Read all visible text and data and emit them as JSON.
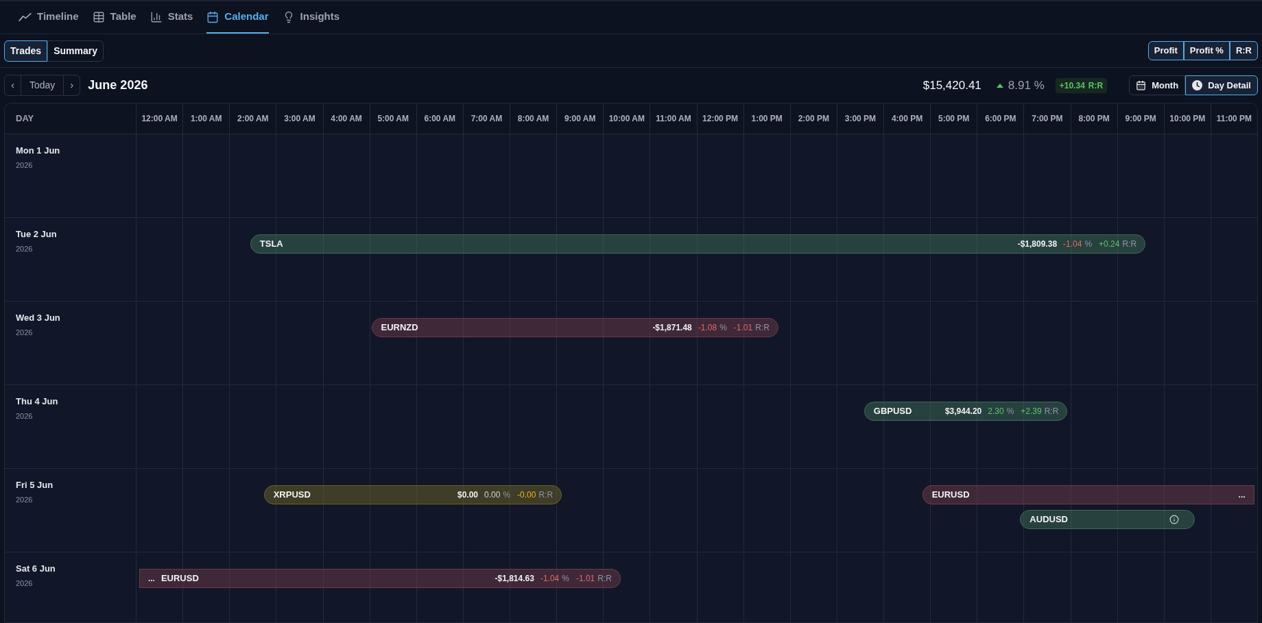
{
  "nav_tabs": [
    {
      "label": "Timeline",
      "selected": false
    },
    {
      "label": "Table",
      "selected": false
    },
    {
      "label": "Stats",
      "selected": false
    },
    {
      "label": "Calendar",
      "selected": true
    },
    {
      "label": "Insights",
      "selected": false
    }
  ],
  "view_toggle": [
    {
      "label": "Trades",
      "selected": true
    },
    {
      "label": "Summary",
      "selected": false
    }
  ],
  "metric_toggle": [
    {
      "label": "Profit",
      "selected": true
    },
    {
      "label": "Profit %",
      "selected": true
    },
    {
      "label": "R:R",
      "selected": true
    }
  ],
  "period_nav": {
    "previous": "‹",
    "today": "Today",
    "next": "›",
    "title": "June 2026"
  },
  "summary": {
    "profit": "$15,420.41",
    "rising": true,
    "percent": "8.91 %",
    "rr": {
      "value": "+10.34",
      "unit": "R:R",
      "color": "#5cc46a"
    }
  },
  "range_toggle": [
    {
      "label": "Month",
      "selected": false
    },
    {
      "label": "Day Detail",
      "selected": true
    }
  ],
  "calendar": {
    "day_heading": "DAY",
    "hours": [
      "12:00 AM",
      "1:00 AM",
      "2:00 AM",
      "3:00 AM",
      "4:00 AM",
      "5:00 AM",
      "6:00 AM",
      "7:00 AM",
      "8:00 AM",
      "9:00 AM",
      "10:00 AM",
      "11:00 AM",
      "12:00 PM",
      "1:00 PM",
      "2:00 PM",
      "3:00 PM",
      "4:00 PM",
      "5:00 PM",
      "6:00 PM",
      "7:00 PM",
      "8:00 PM",
      "9:00 PM",
      "10:00 PM",
      "11:00 PM"
    ],
    "days": [
      {
        "date": "Mon 1 Jun",
        "year": "2026"
      },
      {
        "date": "Tue 2 Jun",
        "year": "2026",
        "trades": [
          {
            "symbol": "TSLA",
            "color": "#3e6b56",
            "pnl": "-$1,809.38",
            "pct": {
              "value": "-1.04",
              "unit": "%",
              "color": "#e06a6a"
            },
            "rr": {
              "value": "+0.24",
              "unit": "R:R",
              "color": "#5cc46a"
            },
            "info": false
          }
        ]
      },
      {
        "date": "Wed 3 Jun",
        "year": "2026",
        "trades": [
          {
            "symbol": "EURNZD",
            "color": "#6e3a48",
            "pnl": "-$1,871.48",
            "pct": {
              "value": "-1.08",
              "unit": "%",
              "color": "#e06a6a"
            },
            "rr": {
              "value": "-1.01",
              "unit": "R:R",
              "color": "#e06a6a"
            },
            "info": false
          }
        ]
      },
      {
        "date": "Thu 4 Jun",
        "year": "2026",
        "trades": [
          {
            "symbol": "GBPUSD",
            "color": "#3e6b56",
            "pnl": "$3,944.20",
            "pct": {
              "value": "2.30",
              "unit": "%",
              "color": "#5cc46a"
            },
            "rr": {
              "value": "+2.39",
              "unit": "R:R",
              "color": "#5cc46a"
            },
            "info": false
          }
        ]
      },
      {
        "date": "Fri 5 Jun",
        "year": "2026",
        "trades": [
          {
            "symbol": "XRPUSD",
            "color": "#6d6225",
            "pnl": "$0.00",
            "pct": {
              "value": "0.00",
              "unit": "%",
              "color": "#d1d5db"
            },
            "rr": {
              "value": "-0.00",
              "unit": "R:R",
              "color": "#e6b422"
            },
            "info": false
          },
          {
            "symbol": "EURUSD",
            "color": "#6e3a48",
            "suffix": "...",
            "info": false
          },
          {
            "symbol": "AUDUSD",
            "color": "#3e6b56",
            "info": true
          }
        ]
      },
      {
        "date": "Sat 6 Jun",
        "year": "2026",
        "trades": [
          {
            "symbol": "EURUSD",
            "color": "#6e3a48",
            "prefix": "...",
            "pnl": "-$1,814.63",
            "pct": {
              "value": "-1.04",
              "unit": "%",
              "color": "#e06a6a"
            },
            "rr": {
              "value": "-1.01",
              "unit": "R:R",
              "color": "#e06a6a"
            },
            "info": false
          }
        ]
      }
    ]
  }
}
